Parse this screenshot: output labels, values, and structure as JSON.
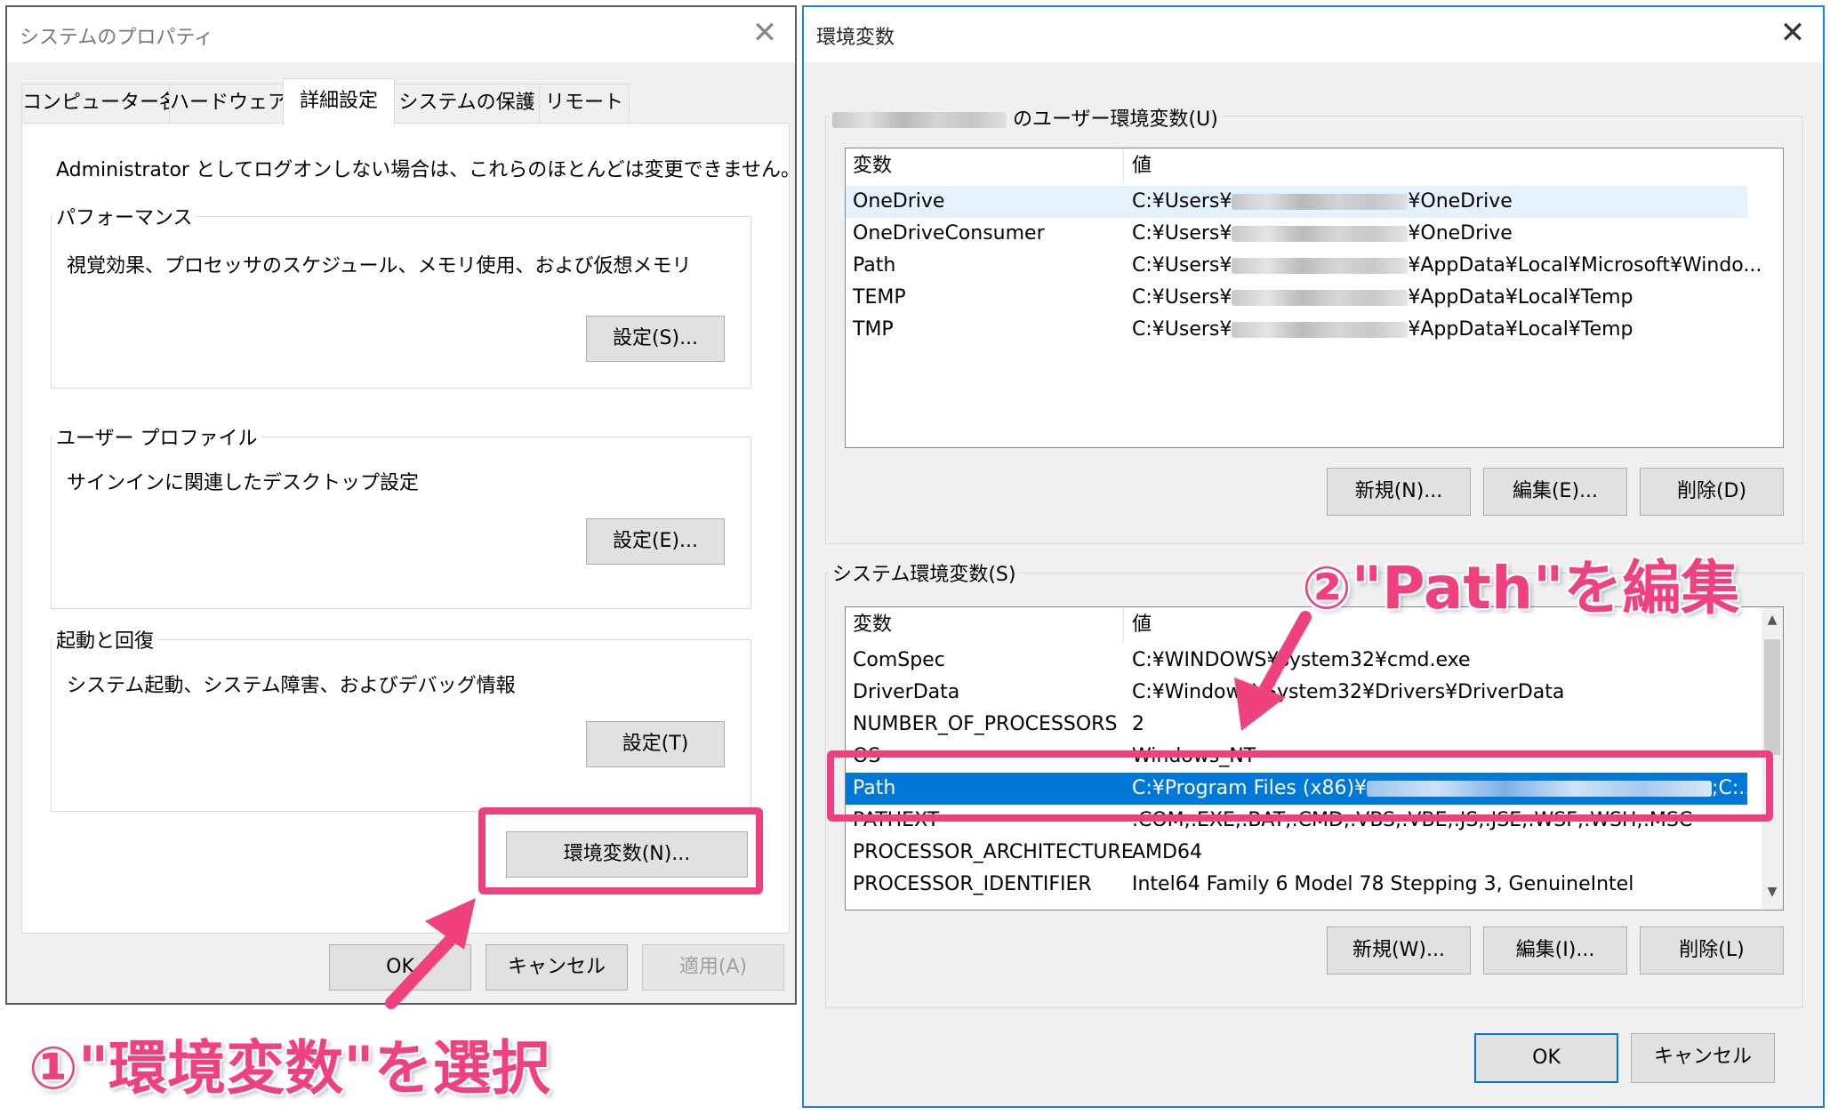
{
  "left_window": {
    "title": "システムのプロパティ",
    "tabs": [
      {
        "label": "コンピューター名"
      },
      {
        "label": "ハードウェア"
      },
      {
        "label": "詳細設定"
      },
      {
        "label": "システムの保護"
      },
      {
        "label": "リモート"
      }
    ],
    "admin_note": "Administrator としてログオンしない場合は、これらのほとんどは変更できません。",
    "performance": {
      "label": "パフォーマンス",
      "desc": "視覚効果、プロセッサのスケジュール、メモリ使用、および仮想メモリ",
      "button": "設定(S)..."
    },
    "user_profile": {
      "label": "ユーザー プロファイル",
      "desc": "サインインに関連したデスクトップ設定",
      "button": "設定(E)..."
    },
    "startup": {
      "label": "起動と回復",
      "desc": "システム起動、システム障害、およびデバッグ情報",
      "button": "設定(T)"
    },
    "env_button": "環境変数(N)...",
    "ok": "OK",
    "cancel": "キャンセル",
    "apply": "適用(A)"
  },
  "right_window": {
    "title": "環境変数",
    "user_group_label": "のユーザー環境変数(U)",
    "col_var": "変数",
    "col_val": "値",
    "user_vars": [
      {
        "name": "OneDrive",
        "pre": "C:¥Users¥",
        "post": "¥OneDrive"
      },
      {
        "name": "OneDriveConsumer",
        "pre": "C:¥Users¥",
        "post": "¥OneDrive"
      },
      {
        "name": "Path",
        "pre": "C:¥Users¥",
        "post": "¥AppData¥Local¥Microsoft¥Windo..."
      },
      {
        "name": "TEMP",
        "pre": "C:¥Users¥",
        "post": "¥AppData¥Local¥Temp"
      },
      {
        "name": "TMP",
        "pre": "C:¥Users¥",
        "post": "¥AppData¥Local¥Temp"
      }
    ],
    "user_buttons": {
      "new": "新規(N)...",
      "edit": "編集(E)...",
      "delete": "削除(D)"
    },
    "system_group_label": "システム環境変数(S)",
    "system_vars": [
      {
        "name": "ComSpec",
        "value": "C:¥WINDOWS¥system32¥cmd.exe"
      },
      {
        "name": "DriverData",
        "value": "C:¥Windows¥System32¥Drivers¥DriverData"
      },
      {
        "name": "NUMBER_OF_PROCESSORS",
        "value": "2"
      },
      {
        "name": "OS",
        "value": "Windows_NT"
      },
      {
        "name": "Path",
        "pre": "C:¥Program Files (x86)¥",
        "post": ";C:..."
      },
      {
        "name": "PATHEXT",
        "value": ".COM;.EXE;.BAT;.CMD;.VBS;.VBE;.JS;.JSE;.WSF;.WSH;.MSC"
      },
      {
        "name": "PROCESSOR_ARCHITECTURE",
        "value": "AMD64"
      },
      {
        "name": "PROCESSOR_IDENTIFIER",
        "value": "Intel64 Family 6 Model 78 Stepping 3, GenuineIntel"
      }
    ],
    "system_buttons": {
      "new": "新規(W)...",
      "edit": "編集(I)...",
      "delete": "削除(L)"
    },
    "ok": "OK",
    "cancel": "キャンセル"
  },
  "annotations": {
    "step1": "①\"環境変数\"を選択",
    "step2": "②\"Path\"を編集"
  },
  "colors": {
    "highlight": "#f0417f",
    "selection": "#0078d7"
  }
}
